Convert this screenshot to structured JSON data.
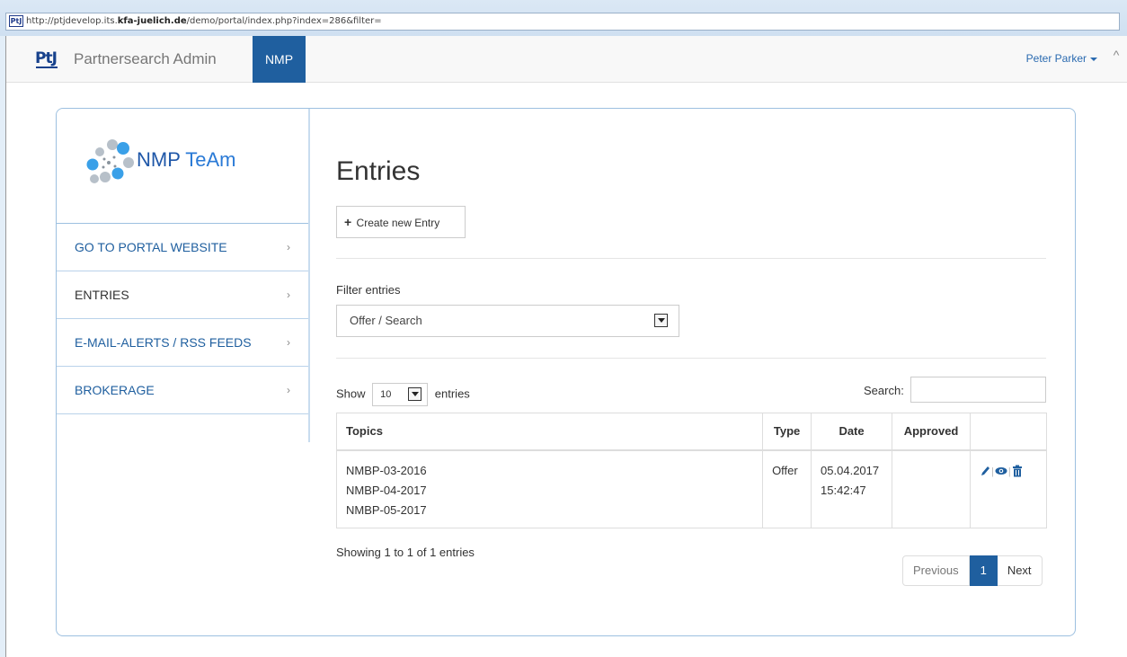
{
  "browser": {
    "favicon_text": "PtJ",
    "url_prefix": "http://ptjdevelop.its.",
    "url_domain": "kfa-juelich.de",
    "url_suffix": "/demo/portal/index.php?index=286&filter="
  },
  "navbar": {
    "brand_logo": "PtJ",
    "brand_name": "Partnersearch Admin",
    "nav_item": "NMP",
    "user_name": "Peter Parker"
  },
  "sidebar": {
    "logo_nmp": "NMP",
    "logo_team": " TeAm",
    "items": [
      {
        "label": "GO TO PORTAL WEBSITE"
      },
      {
        "label": "ENTRIES"
      },
      {
        "label": "E-MAIL-ALERTS / RSS FEEDS"
      },
      {
        "label": "BROKERAGE"
      }
    ],
    "chevron": "›"
  },
  "content": {
    "title": "Entries",
    "create_button": "Create new Entry",
    "filter_label": "Filter entries",
    "filter_value": "Offer / Search",
    "show_label": "Show",
    "length_value": "10",
    "entries_label": "entries",
    "search_label": "Search:",
    "search_value": "",
    "columns": [
      "Topics",
      "Type",
      "Date",
      "Approved",
      ""
    ],
    "rows": [
      {
        "topics": [
          "NMBP-03-2016",
          "NMBP-04-2017",
          "NMBP-05-2017"
        ],
        "type": "Offer",
        "date": "05.04.2017",
        "time": "15:42:47",
        "approved": ""
      }
    ],
    "info": "Showing 1 to 1 of 1 entries",
    "pagination": {
      "previous": "Previous",
      "current": "1",
      "next": "Next"
    }
  },
  "icons": {
    "edit": "pencil-icon",
    "view": "eye-icon",
    "delete": "trash-icon"
  },
  "colors": {
    "primary": "#1f5f9f",
    "link": "#2a6ab0",
    "panel_border": "#9dc0e0"
  }
}
